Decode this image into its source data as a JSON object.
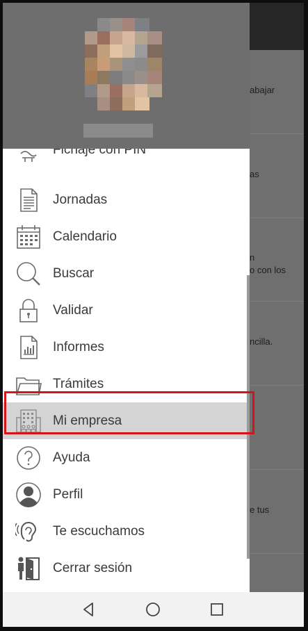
{
  "colors": {
    "accent_highlight": "#d4141a",
    "selected_bg": "#d4d4d4",
    "header_bg": "#6e6e6e",
    "icon_stroke": "#6b6b6b"
  },
  "background_content": [
    {
      "text": "abajar"
    },
    {
      "text": "as"
    },
    {
      "text": "n\no con los"
    },
    {
      "text": "ncilla."
    },
    {
      "text": "e tus"
    }
  ],
  "menu": {
    "items": [
      {
        "label": "Fichaje con PIN",
        "icon": "fingerprint-icon"
      },
      {
        "label": "Jornadas",
        "icon": "document-icon"
      },
      {
        "label": "Calendario",
        "icon": "calendar-icon"
      },
      {
        "label": "Buscar",
        "icon": "search-icon"
      },
      {
        "label": "Validar",
        "icon": "lock-icon"
      },
      {
        "label": "Informes",
        "icon": "report-icon"
      },
      {
        "label": "Trámites",
        "icon": "folder-icon"
      },
      {
        "label": "Mi empresa",
        "icon": "building-icon",
        "selected": true
      },
      {
        "label": "Ayuda",
        "icon": "help-icon"
      },
      {
        "label": "Perfil",
        "icon": "user-icon"
      },
      {
        "label": "Te escuchamos",
        "icon": "ear-icon"
      },
      {
        "label": "Cerrar sesión",
        "icon": "logout-icon"
      }
    ]
  },
  "navbar": {
    "buttons": [
      "back-icon",
      "home-icon",
      "recents-icon"
    ]
  }
}
